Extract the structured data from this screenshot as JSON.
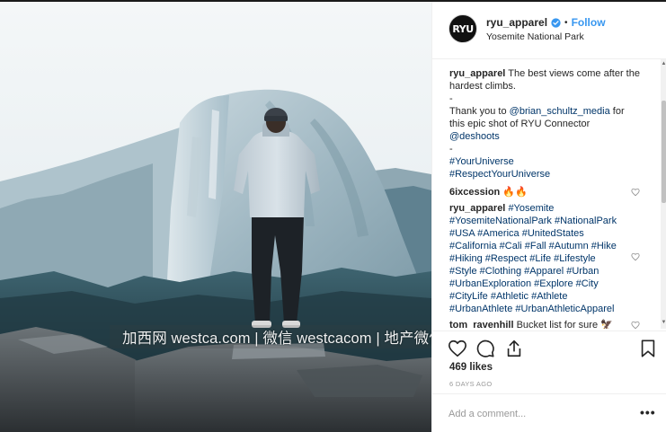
{
  "post": {
    "username": "ryu_apparel",
    "avatar_text": "RYU",
    "verified": true,
    "follow_label": "Follow",
    "separator": "•",
    "location": "Yosemite National Park"
  },
  "photo": {
    "alt": "Man in grey hoodie standing on a rock facing Half Dome"
  },
  "watermark": {
    "text": "加西网 westca.com | 微信 westcacom | 地产微信 westcahouse"
  },
  "caption": {
    "username": "ryu_apparel",
    "line1": "The best views come after the",
    "line2": "hardest climbs.",
    "sep1": "-",
    "thanks1": "Thank you to ",
    "mention1": "@brian_schultz_media",
    "thanks2": " for",
    "line4": "this epic shot of RYU Connector",
    "mention2": "@deshoots",
    "sep2": "-",
    "tag1": "#YourUniverse",
    "tag2": "#RespectYourUniverse"
  },
  "comments": [
    {
      "username": "6ixcession",
      "text": " 🔥🔥"
    },
    {
      "username": "ryu_apparel",
      "lines": [
        "#Yosemite",
        "#YosemiteNationalPark #NationalPark",
        "#USA #America #UnitedStates",
        "#California #Cali #Fall #Autumn #Hike",
        "#Hiking #Respect #Life #Lifestyle",
        "#Style #Clothing #Apparel #Urban",
        "#UrbanExploration #Explore #City",
        "#CityLife #Athletic #Athlete",
        "#UrbanAthlete #UrbanAthleticApparel"
      ]
    },
    {
      "username": "tom_ravenhill",
      "text": " Bucket list for sure 🦅"
    }
  ],
  "engagement": {
    "likes": "469 likes",
    "time_ago": "6 DAYS AGO"
  },
  "add_comment": {
    "placeholder": "Add a comment...",
    "more_label": "•••"
  },
  "icons": [
    "verified-badge-icon",
    "heart-icon",
    "comment-icon",
    "share-icon",
    "bookmark-icon",
    "more-options-icon",
    "comment-like-heart-icon",
    "scroll-up-arrow-icon",
    "scroll-down-arrow-icon"
  ],
  "colors": {
    "link_blue": "#3897f0",
    "hashtag": "#003569",
    "text": "#262626",
    "muted": "#999999",
    "border": "#efefef"
  }
}
